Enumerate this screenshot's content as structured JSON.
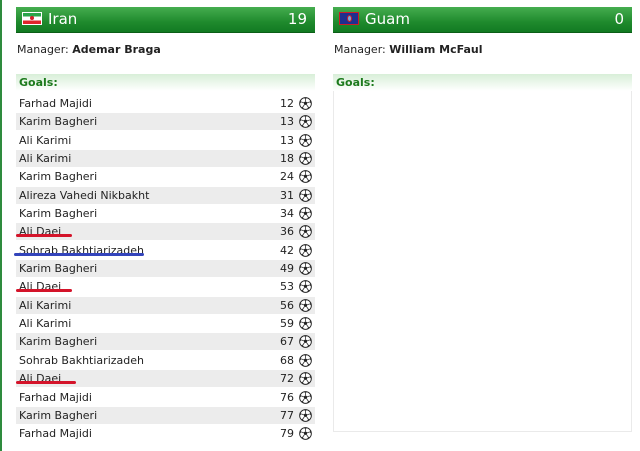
{
  "home": {
    "name": "Iran",
    "score": "19",
    "flag_icon": "iran-flag-icon",
    "manager_label": "Manager:",
    "manager_name": "Ademar Braga",
    "goals_label": "Goals:",
    "goals": [
      {
        "scorer": "Farhad Majidi",
        "minute": "12"
      },
      {
        "scorer": "Karim Bagheri",
        "minute": "13"
      },
      {
        "scorer": "Ali Karimi",
        "minute": "13"
      },
      {
        "scorer": "Ali Karimi",
        "minute": "18"
      },
      {
        "scorer": "Karim Bagheri",
        "minute": "24"
      },
      {
        "scorer": "Alireza Vahedi Nikbakht",
        "minute": "31"
      },
      {
        "scorer": "Karim Bagheri",
        "minute": "34"
      },
      {
        "scorer": "Ali Daei",
        "minute": "36"
      },
      {
        "scorer": "Sohrab Bakhtiarizadeh",
        "minute": "42"
      },
      {
        "scorer": "Karim Bagheri",
        "minute": "49"
      },
      {
        "scorer": "Ali Daei",
        "minute": "53"
      },
      {
        "scorer": "Ali Karimi",
        "minute": "56"
      },
      {
        "scorer": "Ali Karimi",
        "minute": "59"
      },
      {
        "scorer": "Karim Bagheri",
        "minute": "67"
      },
      {
        "scorer": "Sohrab Bakhtiarizadeh",
        "minute": "68"
      },
      {
        "scorer": "Ali Daei",
        "minute": "72"
      },
      {
        "scorer": "Farhad Majidi",
        "minute": "76"
      },
      {
        "scorer": "Karim Bagheri",
        "minute": "77"
      },
      {
        "scorer": "Farhad Majidi",
        "minute": "79"
      }
    ]
  },
  "away": {
    "name": "Guam",
    "score": "0",
    "flag_icon": "guam-flag-icon",
    "manager_label": "Manager:",
    "manager_name": "William McFaul",
    "goals_label": "Goals:",
    "goals": []
  },
  "annotations": {
    "highlight_colors": {
      "red": "#d4142a",
      "blue": "#3344bb"
    }
  },
  "colors": {
    "header_green": "#1f8a2d",
    "goals_label_green": "#1c7a1c",
    "row_stripe": "#ececec"
  }
}
